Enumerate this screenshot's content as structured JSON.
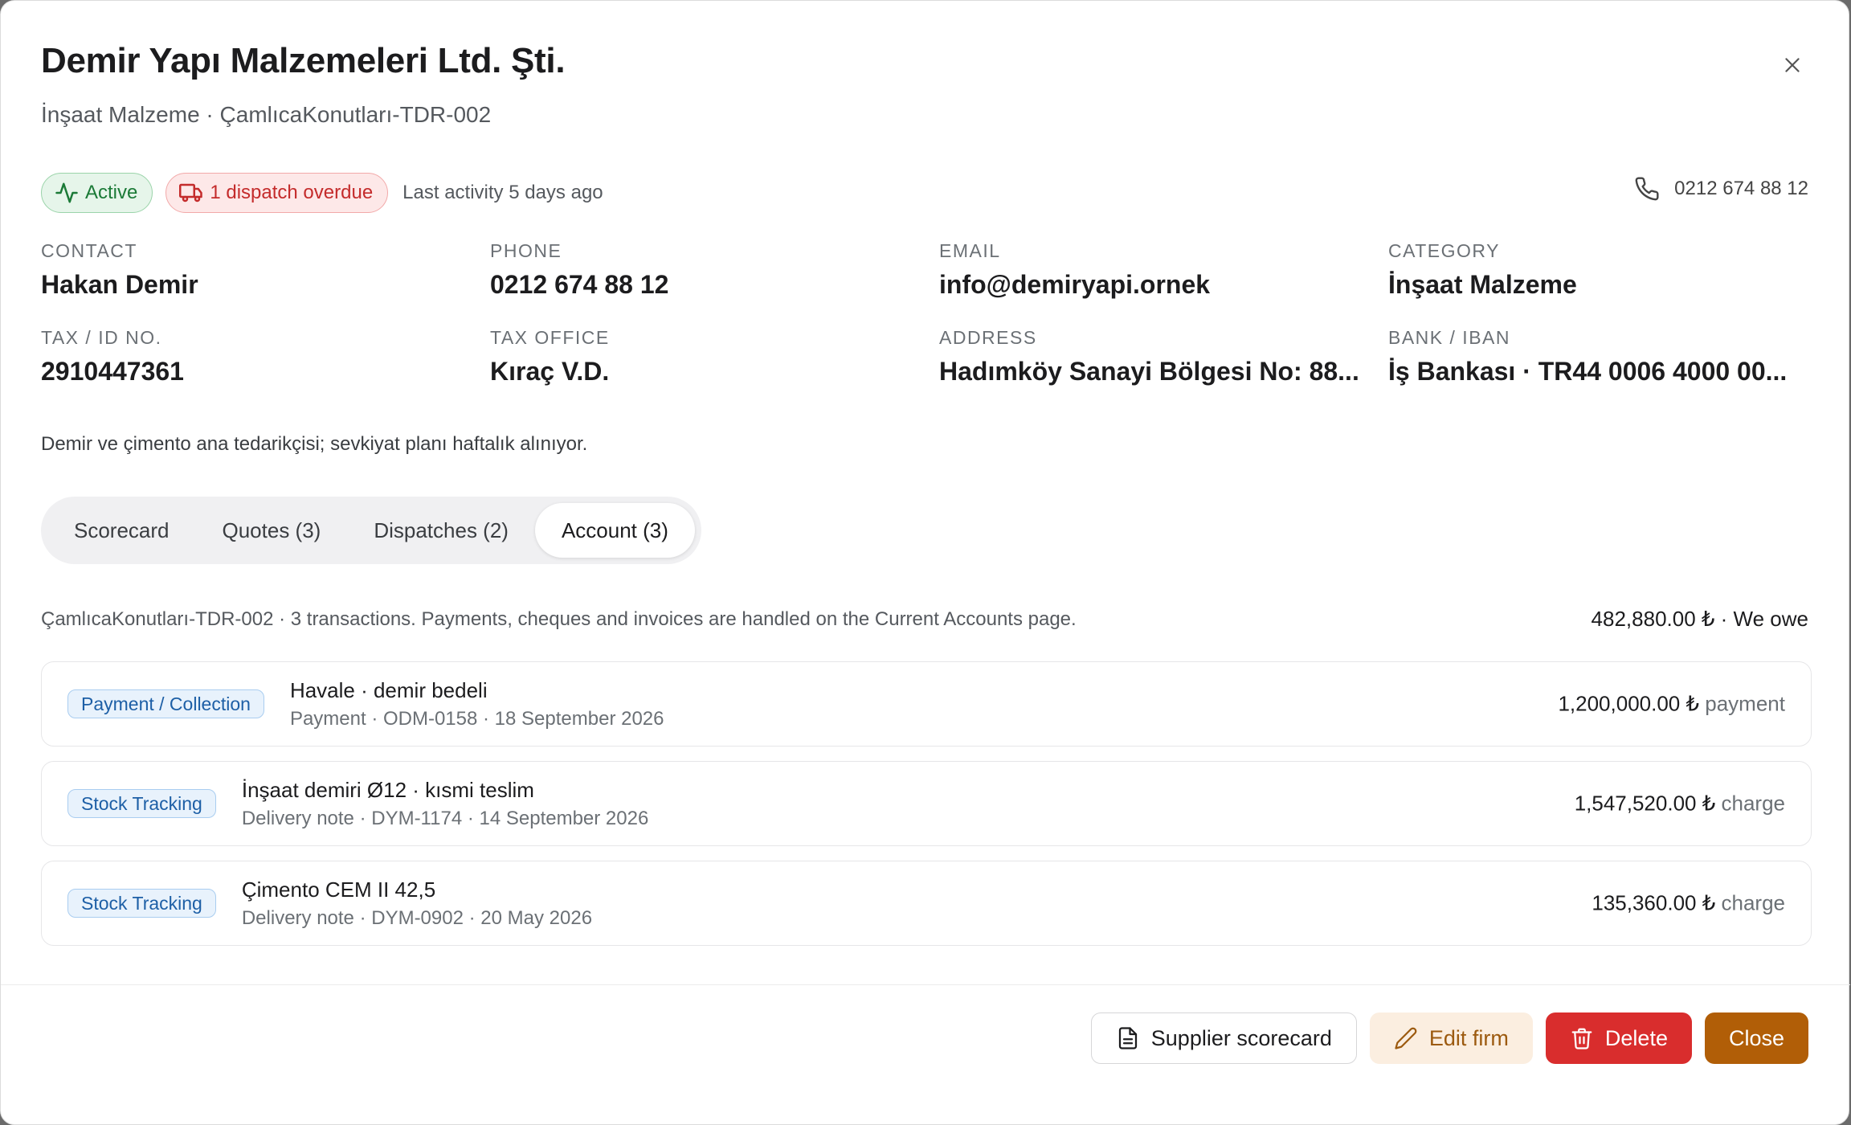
{
  "header": {
    "title": "Demir Yapı Malzemeleri Ltd. Şti.",
    "subtitle": "İnşaat Malzeme · ÇamlıcaKonutları-TDR-002"
  },
  "status": {
    "active_label": "Active",
    "overdue_label": "1 dispatch overdue",
    "last_activity": "Last activity 5 days ago",
    "phone": "0212 674 88 12"
  },
  "fields": [
    {
      "label": "CONTACT",
      "value": "Hakan Demir"
    },
    {
      "label": "PHONE",
      "value": "0212 674 88 12"
    },
    {
      "label": "EMAIL",
      "value": "info@demiryapi.ornek"
    },
    {
      "label": "CATEGORY",
      "value": "İnşaat Malzeme"
    },
    {
      "label": "TAX / ID NO.",
      "value": "2910447361"
    },
    {
      "label": "TAX OFFICE",
      "value": "Kıraç V.D."
    },
    {
      "label": "ADDRESS",
      "value": "Hadımköy Sanayi Bölgesi No: 88..."
    },
    {
      "label": "BANK / IBAN",
      "value": "İş Bankası · TR44 0006 4000 00..."
    }
  ],
  "note": "Demir ve çimento ana tedarikçisi; sevkiyat planı haftalık alınıyor.",
  "tabs": [
    {
      "label": "Scorecard"
    },
    {
      "label": "Quotes (3)"
    },
    {
      "label": "Dispatches (2)"
    },
    {
      "label": "Account (3)"
    }
  ],
  "account": {
    "info": "ÇamlıcaKonutları-TDR-002 · 3 transactions. Payments, cheques and invoices are handled on the Current Accounts page.",
    "total": "482,880.00 ₺ · We owe",
    "transactions": [
      {
        "badge": "Payment / Collection",
        "title": "Havale · demir bedeli",
        "sub": "Payment · ODM-0158 · 18 September 2026",
        "amount": "1,200,000.00 ₺",
        "kind": "payment"
      },
      {
        "badge": "Stock Tracking",
        "title": "İnşaat demiri Ø12 · kısmi teslim",
        "sub": "Delivery note · DYM-1174 · 14 September 2026",
        "amount": "1,547,520.00 ₺",
        "kind": "charge"
      },
      {
        "badge": "Stock Tracking",
        "title": "Çimento CEM II 42,5",
        "sub": "Delivery note · DYM-0902 · 20 May 2026",
        "amount": "135,360.00 ₺",
        "kind": "charge"
      }
    ]
  },
  "footer": {
    "scorecard_label": "Supplier scorecard",
    "edit_label": "Edit firm",
    "delete_label": "Delete",
    "close_label": "Close"
  },
  "colors": {
    "accent": "#b15e07",
    "danger": "#d92d2d",
    "success": "#1b7a37",
    "info": "#1d5fa6"
  },
  "icons": [
    "close-icon",
    "activity-icon",
    "truck-icon",
    "phone-icon",
    "document-icon",
    "pencil-icon",
    "trash-icon"
  ]
}
